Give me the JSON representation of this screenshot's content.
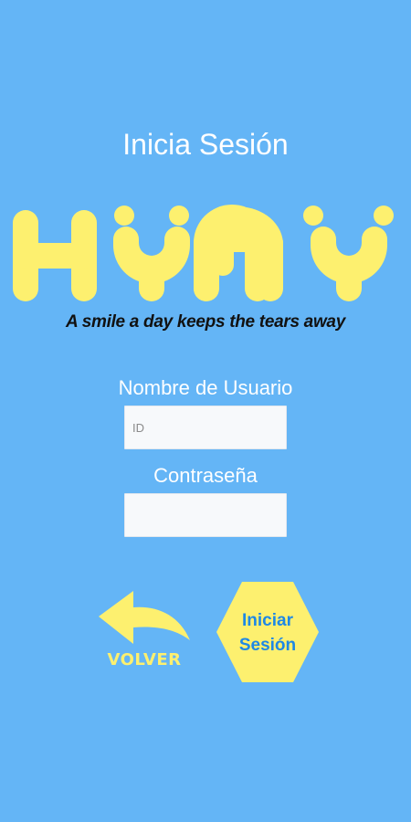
{
  "screen": {
    "title": "Inicia Sesión"
  },
  "logo": {
    "text": "HYMY",
    "tagline": "A smile a day keeps the tears away"
  },
  "form": {
    "username_label": "Nombre de Usuario",
    "username_placeholder": "ID",
    "username_value": "",
    "password_label": "Contraseña",
    "password_value": ""
  },
  "actions": {
    "back_label": "VOLVER",
    "login_line1": "Iniciar",
    "login_line2": "Sesión"
  },
  "colors": {
    "background": "#64b5f6",
    "logo_yellow": "#fdf06f",
    "login_text": "#1e88e5",
    "input_background": "#f7f9fb"
  }
}
